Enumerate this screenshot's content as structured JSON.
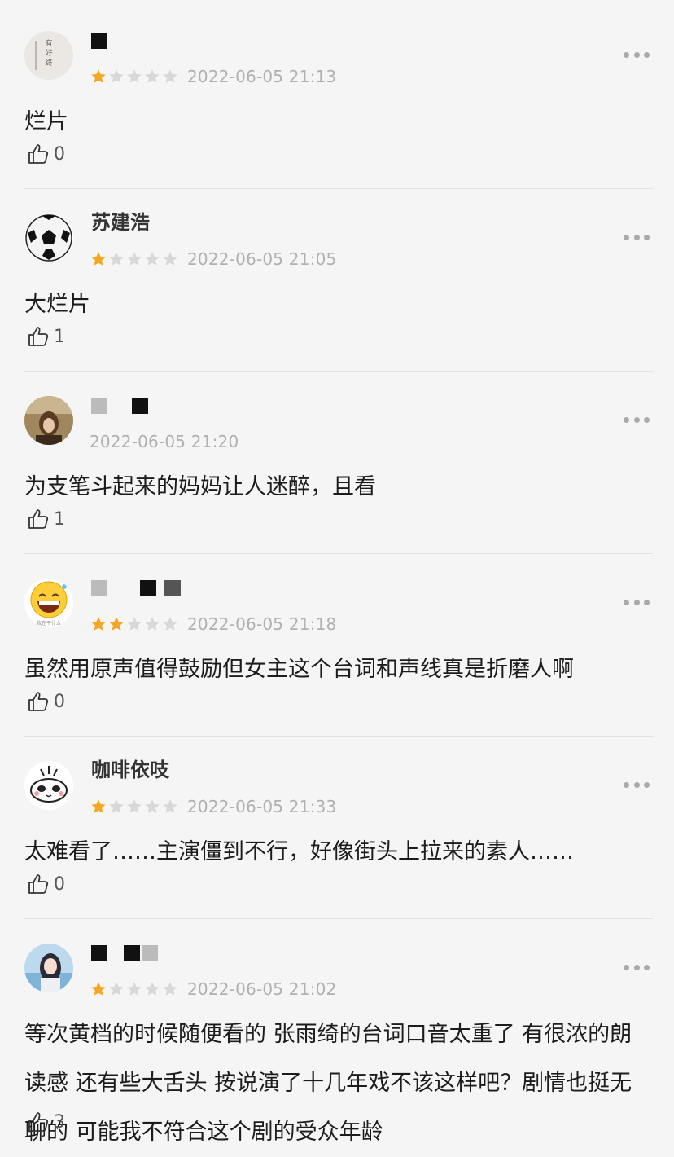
{
  "comments": [
    {
      "username": "",
      "rating": 1,
      "time": "2022-06-05 21:13",
      "text": "烂片",
      "likes": "0",
      "avatar": "book-cover"
    },
    {
      "username": "苏建浩",
      "rating": 1,
      "time": "2022-06-05 21:05",
      "text": "大烂片",
      "likes": "1",
      "avatar": "soccer-ball"
    },
    {
      "username": "",
      "rating": 0,
      "time": "2022-06-05 21:20",
      "text": "为支笔斗起来的妈妈让人迷醉，且看",
      "likes": "1",
      "avatar": "portrait"
    },
    {
      "username": "",
      "rating": 2,
      "time": "2022-06-05 21:18",
      "text": "虽然用原声值得鼓励但女主这个台词和声线真是折磨人啊",
      "likes": "0",
      "avatar": "laughing-emoji"
    },
    {
      "username": "咖啡依吱",
      "rating": 1,
      "time": "2022-06-05 21:33",
      "text": "太难看了……主演僵到不行，好像街头上拉来的素人……",
      "likes": "0",
      "avatar": "cartoon-face"
    },
    {
      "username": "",
      "rating": 1,
      "time": "2022-06-05 21:02",
      "text": "等次黄档的时候随便看的 张雨绮的台词口音太重了 有很浓的朗读感 还有些大舌头 按说演了十几年戏不该这样吧？剧情也挺无聊的 可能我不符合这个剧的受众年龄",
      "likes": "3",
      "avatar": "girl-photo"
    }
  ],
  "colors": {
    "star_on": "#f5a623",
    "star_off": "#d8d8d8",
    "time": "#b0b0b0",
    "background": "#f5f5f5"
  },
  "icons": {
    "like": "thumbs-up-icon",
    "more": "more-dots-icon",
    "star": "star-icon"
  }
}
